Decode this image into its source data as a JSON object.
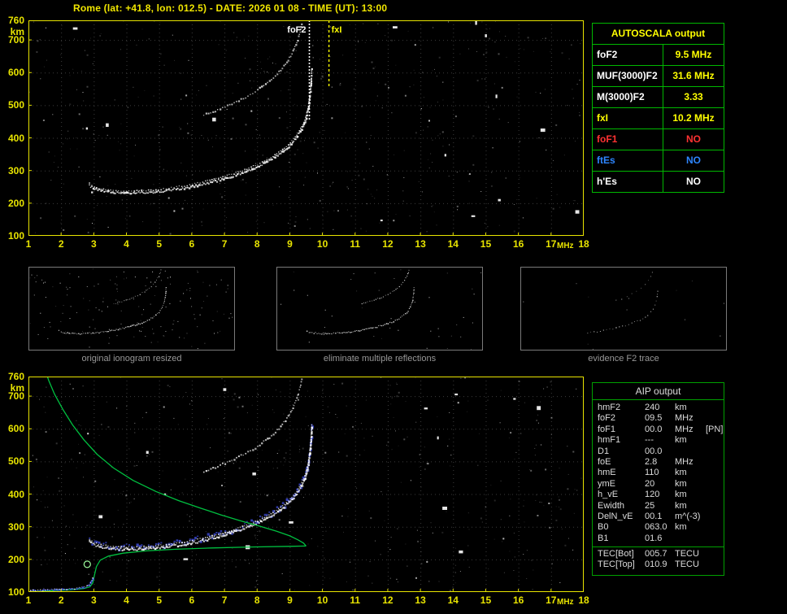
{
  "title": "Rome (lat: +41.8, lon: 012.5) - DATE: 2026 01 08 - TIME (UT): 13:00",
  "colors": {
    "background": "#000000",
    "axis_yellow": "#e8e400",
    "grid_gray": "#3c3c3c",
    "title_yellow": "#f0e600",
    "autoscala_border_green": "#00b800",
    "aip_border_green": "#00a000",
    "trace_white": "#ffffff",
    "profile_green": "#00c040",
    "overlay_blue": "#4858ff",
    "caption_gray": "#989898",
    "value_yellow": "#ffff00",
    "alert_red": "#ff3232",
    "info_blue": "#2e86ff",
    "aip_text": "#dcdcdc"
  },
  "autoscala_table": {
    "title": "AUTOSCALA output",
    "rows": [
      {
        "param": "foF2",
        "value": "9.5 MHz",
        "param_color": "#ffffff",
        "value_color": "#ffff00"
      },
      {
        "param": "MUF(3000)F2",
        "value": "31.6 MHz",
        "param_color": "#ffffff",
        "value_color": "#ffff00"
      },
      {
        "param": "M(3000)F2",
        "value": "3.33",
        "param_color": "#ffffff",
        "value_color": "#ffff00"
      },
      {
        "param": "fxI",
        "value": "10.2 MHz",
        "param_color": "#ffff00",
        "value_color": "#ffff00"
      },
      {
        "param": "foF1",
        "value": "NO",
        "param_color": "#ff3232",
        "value_color": "#ff3232"
      },
      {
        "param": "ftEs",
        "value": "NO",
        "param_color": "#2e86ff",
        "value_color": "#2e86ff"
      },
      {
        "param": "h'Es",
        "value": "NO",
        "param_color": "#ffffff",
        "value_color": "#ffffff"
      }
    ]
  },
  "aip_table": {
    "title": "AIP output",
    "rows": [
      {
        "name": "hmF2",
        "value": "240",
        "unit": "km",
        "note": ""
      },
      {
        "name": "foF2",
        "value": "09.5",
        "unit": "MHz",
        "note": ""
      },
      {
        "name": "foF1",
        "value": "00.0",
        "unit": "MHz",
        "note": "[PN]"
      },
      {
        "name": "hmF1",
        "value": "---",
        "unit": "km",
        "note": ""
      },
      {
        "name": "D1",
        "value": "00.0",
        "unit": "",
        "note": ""
      },
      {
        "name": "foE",
        "value": "2.8",
        "unit": "MHz",
        "note": ""
      },
      {
        "name": "hmE",
        "value": "110",
        "unit": "km",
        "note": ""
      },
      {
        "name": "ymE",
        "value": "20",
        "unit": "km",
        "note": ""
      },
      {
        "name": "h_vE",
        "value": "120",
        "unit": "km",
        "note": ""
      },
      {
        "name": "Ewidth",
        "value": "25",
        "unit": "km",
        "note": ""
      },
      {
        "name": "DelN_vE",
        "value": "00.1",
        "unit": "m^(-3)",
        "note": ""
      },
      {
        "name": "B0",
        "value": "063.0",
        "unit": "km",
        "note": ""
      },
      {
        "name": "B1",
        "value": "01.6",
        "unit": "",
        "note": ""
      }
    ],
    "tec_rows": [
      {
        "name": "TEC[Bot]",
        "value": "005.7",
        "unit": "TECU",
        "note": ""
      },
      {
        "name": "TEC[Top]",
        "value": "010.9",
        "unit": "TECU",
        "note": ""
      }
    ]
  },
  "thumbnails": [
    {
      "caption": "original ionogram resized"
    },
    {
      "caption": "eliminate multiple reflections"
    },
    {
      "caption": "evidence F2 trace"
    }
  ],
  "chart_data": {
    "type": "scatter",
    "xlabel": "MHz",
    "ylabel": "km",
    "xlim": [
      1,
      18
    ],
    "ylim": [
      100,
      760
    ],
    "x_ticks": [
      1,
      2,
      3,
      4,
      5,
      6,
      7,
      8,
      9,
      10,
      11,
      12,
      13,
      14,
      15,
      16,
      17,
      18
    ],
    "y_ticks": [
      760,
      700,
      600,
      500,
      400,
      300,
      200,
      100
    ],
    "foF2_line_mhz": 9.6,
    "fxI_line_mhz": 10.2,
    "labels": {
      "foF2_label": "foF2",
      "fxI_label": "fxI"
    },
    "marker_ehf1": [
      2.8,
      185
    ],
    "traces": {
      "f2_virtual_height": [
        [
          2.85,
          256
        ],
        [
          3.0,
          246
        ],
        [
          3.2,
          240
        ],
        [
          3.5,
          236
        ],
        [
          3.9,
          233
        ],
        [
          4.3,
          233
        ],
        [
          4.8,
          236
        ],
        [
          5.2,
          240
        ],
        [
          5.6,
          246
        ],
        [
          6.0,
          253
        ],
        [
          6.4,
          262
        ],
        [
          6.8,
          272
        ],
        [
          7.2,
          284
        ],
        [
          7.6,
          298
        ],
        [
          8.0,
          314
        ],
        [
          8.35,
          332
        ],
        [
          8.7,
          354
        ],
        [
          9.0,
          380
        ],
        [
          9.2,
          404
        ],
        [
          9.35,
          430
        ],
        [
          9.47,
          458
        ],
        [
          9.55,
          492
        ],
        [
          9.6,
          530
        ],
        [
          9.64,
          575
        ],
        [
          9.66,
          615
        ]
      ],
      "second_hop": [
        [
          6.35,
          472
        ],
        [
          6.7,
          484
        ],
        [
          7.0,
          497
        ],
        [
          7.35,
          512
        ],
        [
          7.7,
          530
        ],
        [
          8.0,
          549
        ],
        [
          8.3,
          571
        ],
        [
          8.6,
          597
        ],
        [
          8.85,
          627
        ],
        [
          9.05,
          660
        ],
        [
          9.2,
          695
        ],
        [
          9.3,
          727
        ],
        [
          9.36,
          760
        ]
      ],
      "profile_bottomside": [
        [
          1.0,
          101
        ],
        [
          1.7,
          104
        ],
        [
          2.3,
          107
        ],
        [
          2.7,
          111
        ],
        [
          2.88,
          116
        ],
        [
          2.97,
          128
        ],
        [
          3.02,
          152
        ],
        [
          3.08,
          178
        ],
        [
          3.2,
          198
        ],
        [
          3.45,
          210
        ],
        [
          3.9,
          219
        ],
        [
          4.6,
          226
        ],
        [
          5.5,
          231
        ],
        [
          6.6,
          235
        ],
        [
          7.8,
          238
        ],
        [
          9.0,
          240
        ],
        [
          9.5,
          241
        ]
      ],
      "profile_topside": [
        [
          9.5,
          241
        ],
        [
          9.42,
          250
        ],
        [
          9.25,
          260
        ],
        [
          9.0,
          272
        ],
        [
          8.6,
          286
        ],
        [
          8.1,
          301
        ],
        [
          7.5,
          318
        ],
        [
          6.9,
          336
        ],
        [
          6.3,
          356
        ],
        [
          5.6,
          380
        ],
        [
          4.9,
          408
        ],
        [
          4.2,
          442
        ],
        [
          3.6,
          480
        ],
        [
          3.1,
          522
        ],
        [
          2.7,
          566
        ],
        [
          2.35,
          612
        ],
        [
          2.05,
          660
        ],
        [
          1.8,
          706
        ],
        [
          1.62,
          748
        ],
        [
          1.58,
          760
        ]
      ],
      "e_layer": [
        [
          1.05,
          106
        ],
        [
          1.5,
          108
        ],
        [
          2.0,
          110
        ],
        [
          2.4,
          112
        ],
        [
          2.7,
          116
        ],
        [
          2.85,
          124
        ],
        [
          2.93,
          138
        ],
        [
          2.97,
          152
        ]
      ]
    }
  }
}
